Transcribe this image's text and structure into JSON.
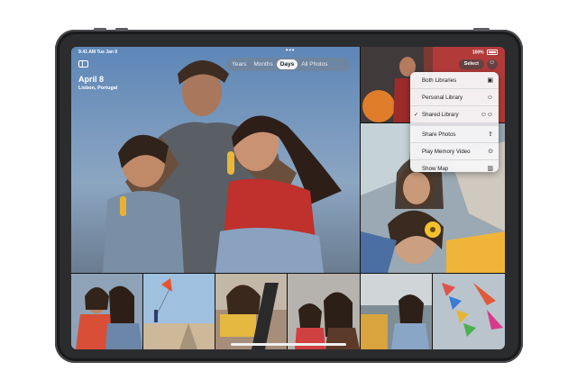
{
  "status": {
    "time": "9:41 AM  Tue Jan 9",
    "battery": "100%"
  },
  "header": {
    "title": "April 8",
    "subtitle": "Lisbon, Portugal"
  },
  "view_tabs": [
    {
      "label": "Years"
    },
    {
      "label": "Months"
    },
    {
      "label": "Days"
    },
    {
      "label": "All Photos"
    }
  ],
  "active_tab": "Days",
  "actions": {
    "select_label": "Select"
  },
  "menu": {
    "items": [
      {
        "label": "Both Libraries",
        "icon": "libraries-icon",
        "checked": false
      },
      {
        "label": "Personal Library",
        "icon": "person-icon",
        "checked": false
      },
      {
        "label": "Shared Library",
        "icon": "people-icon",
        "checked": true
      },
      {
        "label": "Share Photos",
        "icon": "share-icon",
        "checked": false
      },
      {
        "label": "Play Memory Video",
        "icon": "play-icon",
        "checked": false
      },
      {
        "label": "Show Map",
        "icon": "map-icon",
        "checked": false
      }
    ],
    "check_glyph": "✓"
  },
  "colors": {
    "menu_bg": "#f5f5f7",
    "accent": "#ffffff",
    "device": "#2b2c2e"
  }
}
